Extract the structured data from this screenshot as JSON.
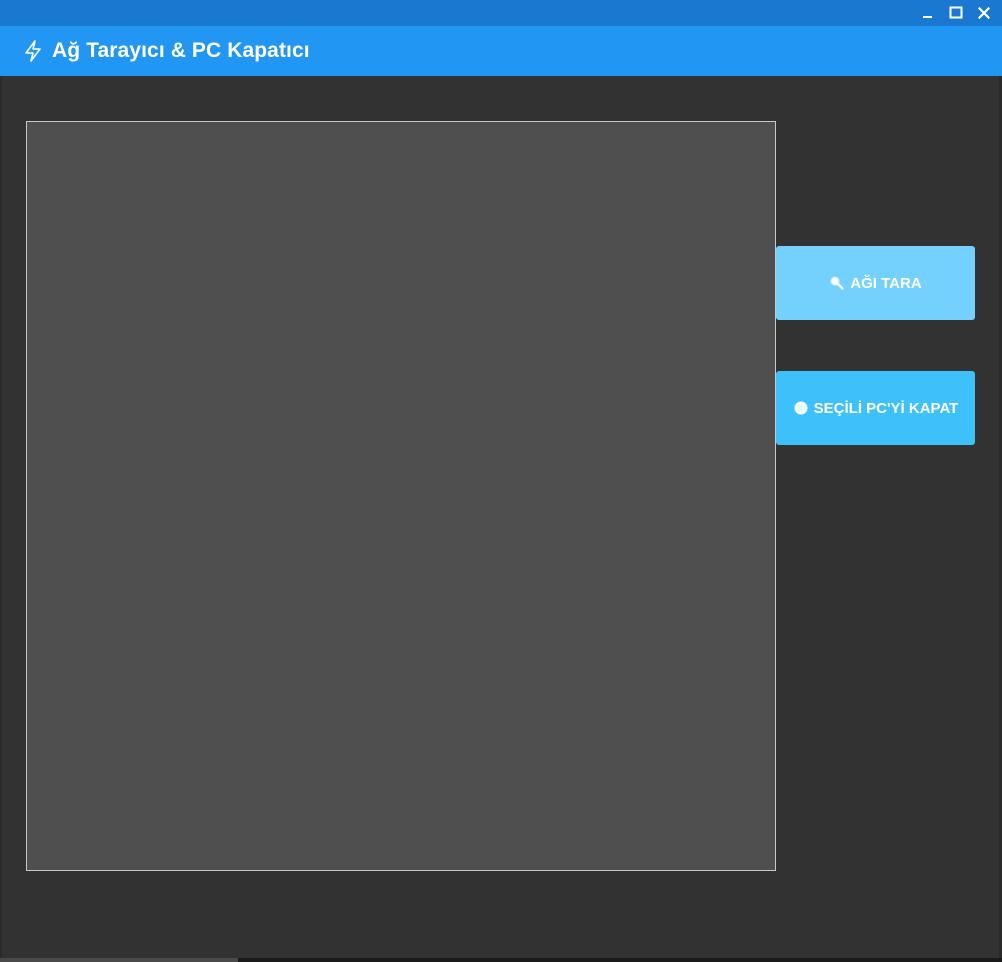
{
  "window": {
    "controls": {
      "minimize_icon": "minimize-icon",
      "maximize_icon": "maximize-icon",
      "close_icon": "close-icon"
    }
  },
  "header": {
    "icon": "lightning-bolt-icon",
    "title": "Ağ Tarayıcı & PC Kapatıcı"
  },
  "device_list": {
    "items": []
  },
  "actions": {
    "scan": {
      "icon": "magnifier-icon",
      "label": "AĞI TARA"
    },
    "shutdown": {
      "icon": "power-dot-icon",
      "label": "SEÇİLİ PC'Yİ KAPAT"
    }
  },
  "colors": {
    "titlebar": "#1b78d0",
    "header": "#2196f3",
    "background": "#323232",
    "list_background": "#4f4f4f",
    "scan_button": "#74d1fd",
    "shutdown_button": "#3ec1fb"
  }
}
